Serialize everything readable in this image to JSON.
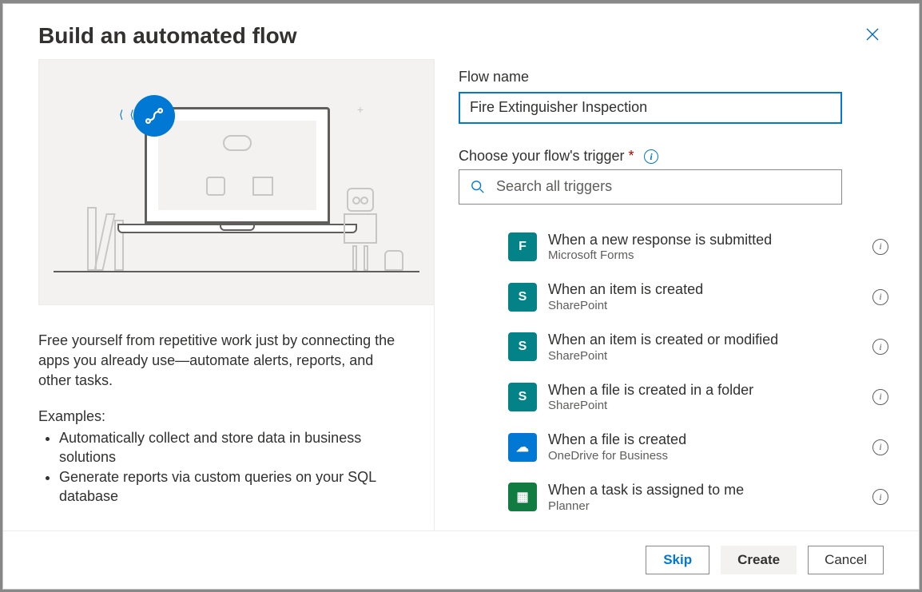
{
  "dialog": {
    "title": "Build an automated flow",
    "close_tooltip": "Close"
  },
  "left": {
    "description": "Free yourself from repetitive work just by connecting the apps you already use—automate alerts, reports, and other tasks.",
    "examples_label": "Examples:",
    "examples": [
      "Automatically collect and store data in business solutions",
      "Generate reports via custom queries on your SQL database"
    ]
  },
  "form": {
    "flow_name_label": "Flow name",
    "flow_name_value": "Fire Extinguisher Inspection",
    "trigger_label": "Choose your flow's trigger",
    "search_placeholder": "Search all triggers"
  },
  "triggers": [
    {
      "title": "When a new response is submitted",
      "subtitle": "Microsoft Forms",
      "icon": "forms",
      "color": "teal"
    },
    {
      "title": "When an item is created",
      "subtitle": "SharePoint",
      "icon": "sharepoint",
      "color": "teal"
    },
    {
      "title": "When an item is created or modified",
      "subtitle": "SharePoint",
      "icon": "sharepoint",
      "color": "teal"
    },
    {
      "title": "When a file is created in a folder",
      "subtitle": "SharePoint",
      "icon": "sharepoint",
      "color": "teal"
    },
    {
      "title": "When a file is created",
      "subtitle": "OneDrive for Business",
      "icon": "onedrive",
      "color": "blue"
    },
    {
      "title": "When a task is assigned to me",
      "subtitle": "Planner",
      "icon": "planner",
      "color": "green"
    }
  ],
  "footer": {
    "skip": "Skip",
    "create": "Create",
    "cancel": "Cancel"
  },
  "icons": {
    "forms": "F",
    "sharepoint": "S",
    "onedrive": "☁",
    "planner": "▦"
  },
  "colors": {
    "primary": "#0078d4",
    "teal": "#038387",
    "green": "#107c41"
  }
}
